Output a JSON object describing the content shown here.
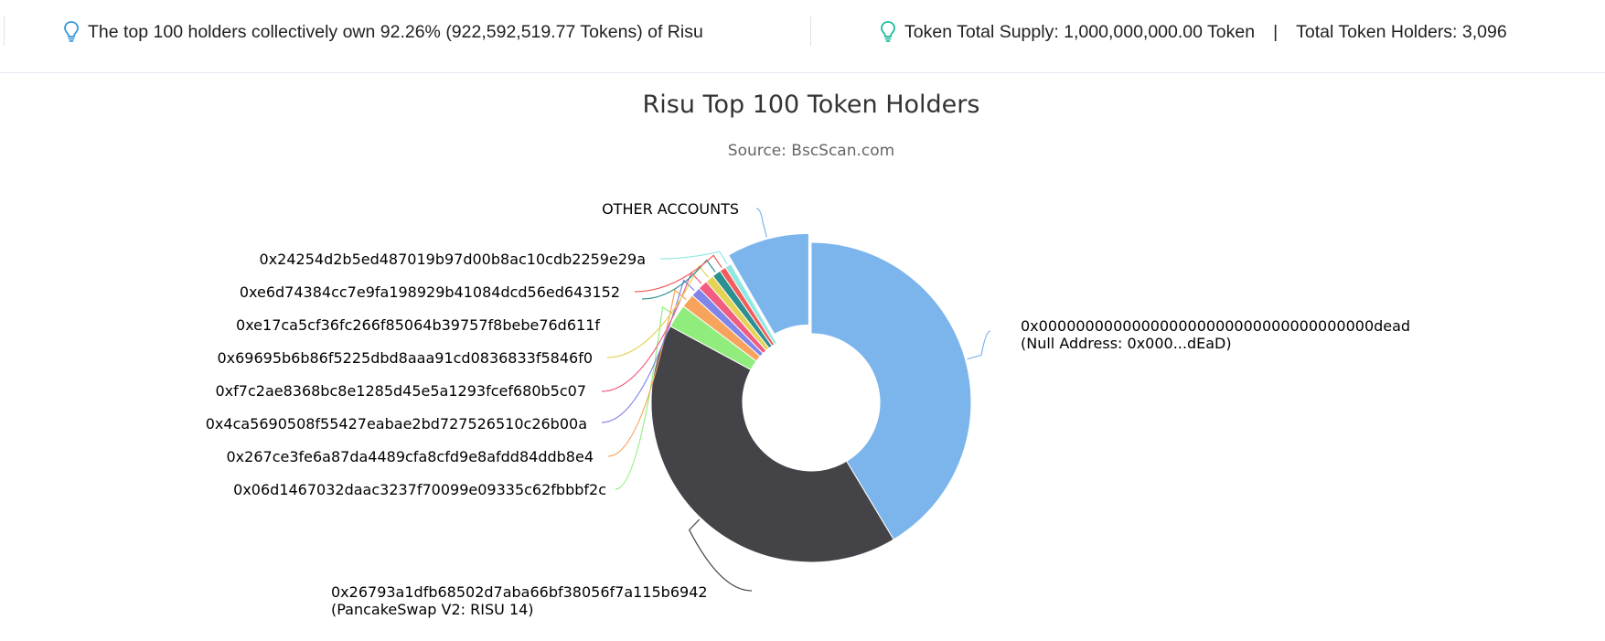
{
  "summary": {
    "top_holders_text": "The top 100 holders collectively own 92.26% (922,592,519.77 Tokens) of Risu",
    "total_supply_text": "Token Total Supply: 1,000,000,000.00 Token",
    "separator": "|",
    "total_holders_text": "Total Token Holders: 3,096"
  },
  "icons": {
    "left": "lightbulb-icon",
    "right": "lightbulb-icon"
  },
  "colors": {
    "bulb_left": "#3498db",
    "bulb_right": "#1abc9c"
  },
  "chart_data": {
    "type": "pie",
    "donut": true,
    "title": "Risu Top 100 Token Holders",
    "subtitle": "Source: BscScan.com",
    "units": "percent",
    "slices": [
      {
        "label": "0x000000000000000000000000000000000000dead",
        "sublabel": "(Null Address: 0x000...dEaD)",
        "value": 38.3,
        "color": "#7cb5ec"
      },
      {
        "label": "0x26793a1dfb68502d7aba66bf38056f7a115b6942",
        "sublabel": "(PancakeSwap V2: RISU 14)",
        "value": 38.4,
        "color": "#434348"
      },
      {
        "label": "0x06d1467032daac3237f70099e09335c62fbbbf2c",
        "value": 2.2,
        "color": "#90ed7d"
      },
      {
        "label": "0x267ce3fe6a87da4489cfa8cfd9e8afdd84ddb8e4",
        "value": 1.3,
        "color": "#f7a35c"
      },
      {
        "label": "0x4ca5690508f55427eabae2bd727526510c26b00a",
        "value": 0.9,
        "color": "#8085e9"
      },
      {
        "label": "0xf7c2ae8368bc8e1285d45e5a1293fcef680b5c07",
        "value": 0.9,
        "color": "#f15c80"
      },
      {
        "label": "0x69695b6b86f5225dbd8aaa91cd0836833f5846f0",
        "value": 0.8,
        "color": "#e4d354"
      },
      {
        "label": "0xe17ca5cf36fc266f85064b39757f8bebe76d611f",
        "value": 0.8,
        "color": "#2b908f"
      },
      {
        "label": "0xe6d74384cc7e9fa198929b41084dcd56ed643152",
        "value": 0.6,
        "color": "#f45b5b"
      },
      {
        "label": "0x24254d2b5ed487019b97d00b8ac10cdb2259e29a",
        "value": 0.6,
        "color": "#91e8e1"
      },
      {
        "label": "OTHER ACCOUNTS",
        "value": 7.74,
        "color": "#7cb5ec",
        "sliced": true
      }
    ]
  }
}
